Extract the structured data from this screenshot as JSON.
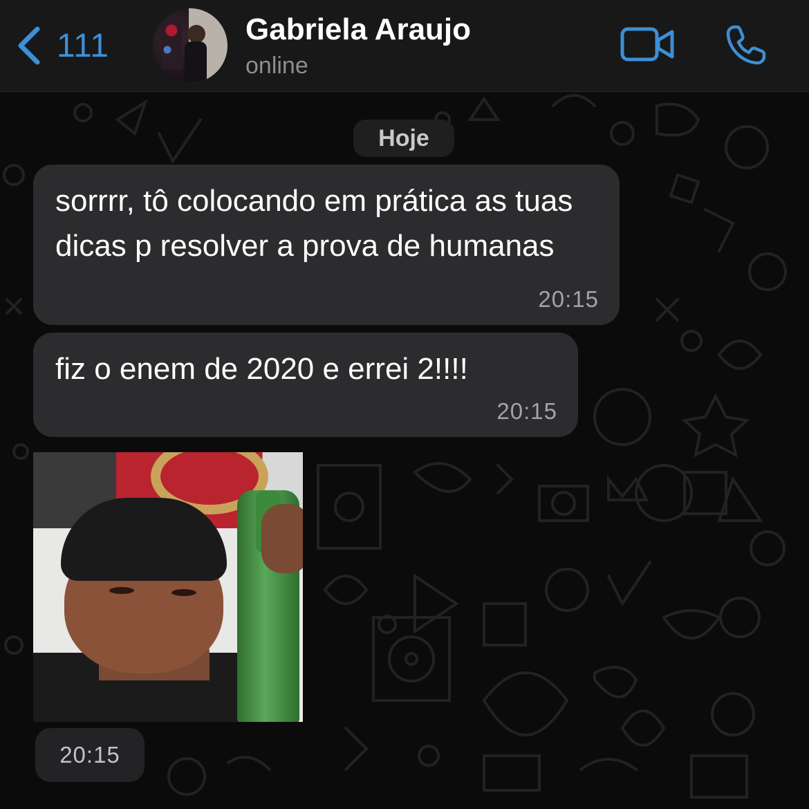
{
  "header": {
    "back_count": "111",
    "contact_name": "Gabriela Araujo",
    "contact_status": "online",
    "accent_color": "#3d8fd6",
    "icons": [
      "chevron-left-icon",
      "video-camera-icon",
      "phone-icon"
    ]
  },
  "chat": {
    "date_label": "Hoje",
    "messages": [
      {
        "type": "text",
        "text": "sorrrr, tô colocando em prática as tuas dicas p resolver a prova de humanas",
        "time": "20:15"
      },
      {
        "type": "text",
        "text": "fiz o enem de 2020 e errei 2!!!!",
        "time": "20:15"
      },
      {
        "type": "image",
        "time": "20:15"
      }
    ],
    "bubble_color": "#2c2c2e"
  }
}
